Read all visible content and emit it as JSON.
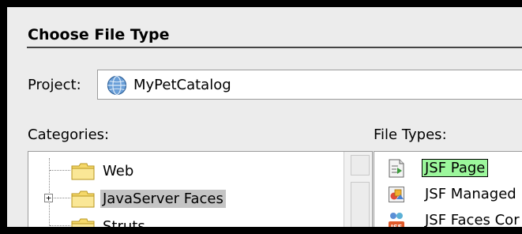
{
  "dialog": {
    "heading": "Choose File Type",
    "project": {
      "label": "Project:",
      "value": "MyPetCatalog",
      "icon": "globe-icon"
    },
    "categories": {
      "label": "Categories:",
      "items": [
        {
          "label": "Web",
          "icon": "folder-icon",
          "expandable": false,
          "selected": false
        },
        {
          "label": "JavaServer Faces",
          "icon": "folder-icon",
          "expandable": true,
          "selected": true
        },
        {
          "label": "Struts",
          "icon": "folder-icon",
          "expandable": false,
          "selected": false
        }
      ]
    },
    "file_types": {
      "label": "File Types:",
      "items": [
        {
          "label": "JSF Page",
          "icon": "jsf-page-icon",
          "selected": true
        },
        {
          "label": "JSF Managed",
          "icon": "managed-bean-icon",
          "selected": false
        },
        {
          "label": "JSF Faces Cor",
          "icon": "faces-config-icon",
          "selected": false
        }
      ]
    }
  },
  "colors": {
    "background": "#ececec",
    "selection_category": "#c4c4c4",
    "selection_filetype": "#9cf79c",
    "folder": "#f5d86a"
  }
}
